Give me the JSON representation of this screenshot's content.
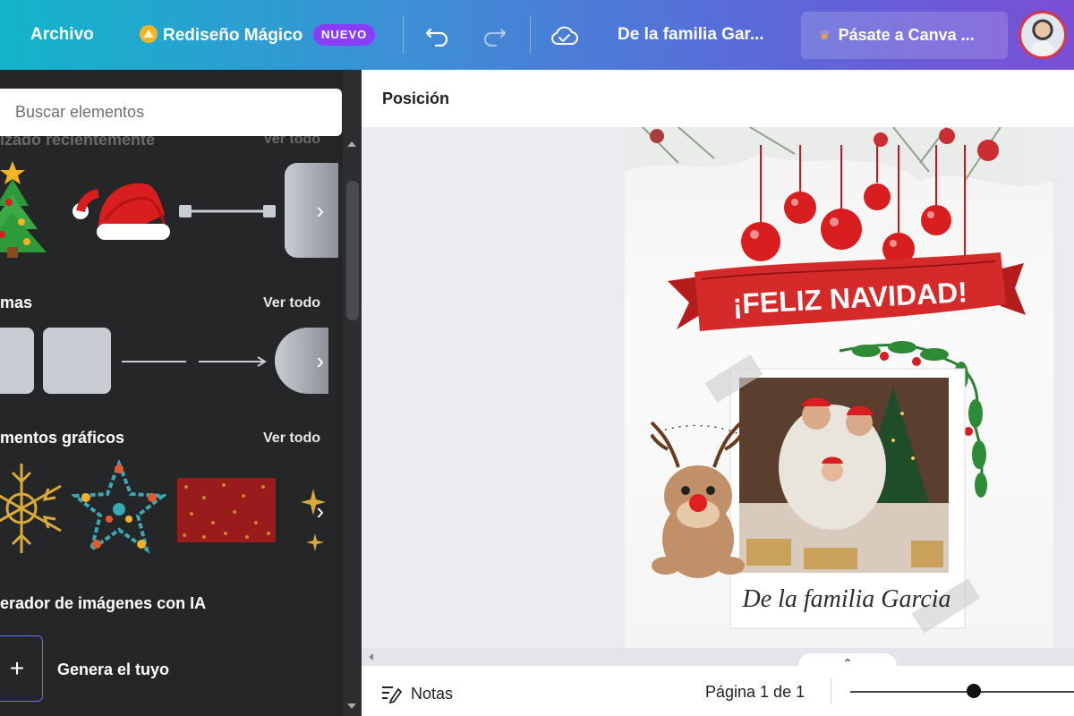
{
  "topbar": {
    "file_menu": "Archivo",
    "magic_redesign": "Rediseño Mágico",
    "new_badge": "NUEVO",
    "doc_title": "De la familia Gar...",
    "upgrade": "Pásate a Canva ..."
  },
  "panel": {
    "search_placeholder": "Buscar elementos",
    "sections": [
      {
        "title": "izado recientemente",
        "see_all": "Ver todo"
      },
      {
        "title": "mas",
        "see_all": "Ver todo"
      },
      {
        "title": "mentos gráficos",
        "see_all": "Ver todo"
      },
      {
        "title": "erador de imágenes con IA"
      }
    ],
    "generate_label": "Genera el tuyo"
  },
  "editor": {
    "position_label": "Posición",
    "card": {
      "banner_text": "¡FELIZ NAVIDAD!",
      "signature": "De la familia Garcia"
    }
  },
  "bottombar": {
    "notes_label": "Notas",
    "page_indicator": "Página 1 de 1",
    "zoom_level": 0.55
  },
  "colors": {
    "accent_purple": "#8b3dff",
    "banner_red": "#d42a2a",
    "ornament_red": "#d81e1e"
  }
}
